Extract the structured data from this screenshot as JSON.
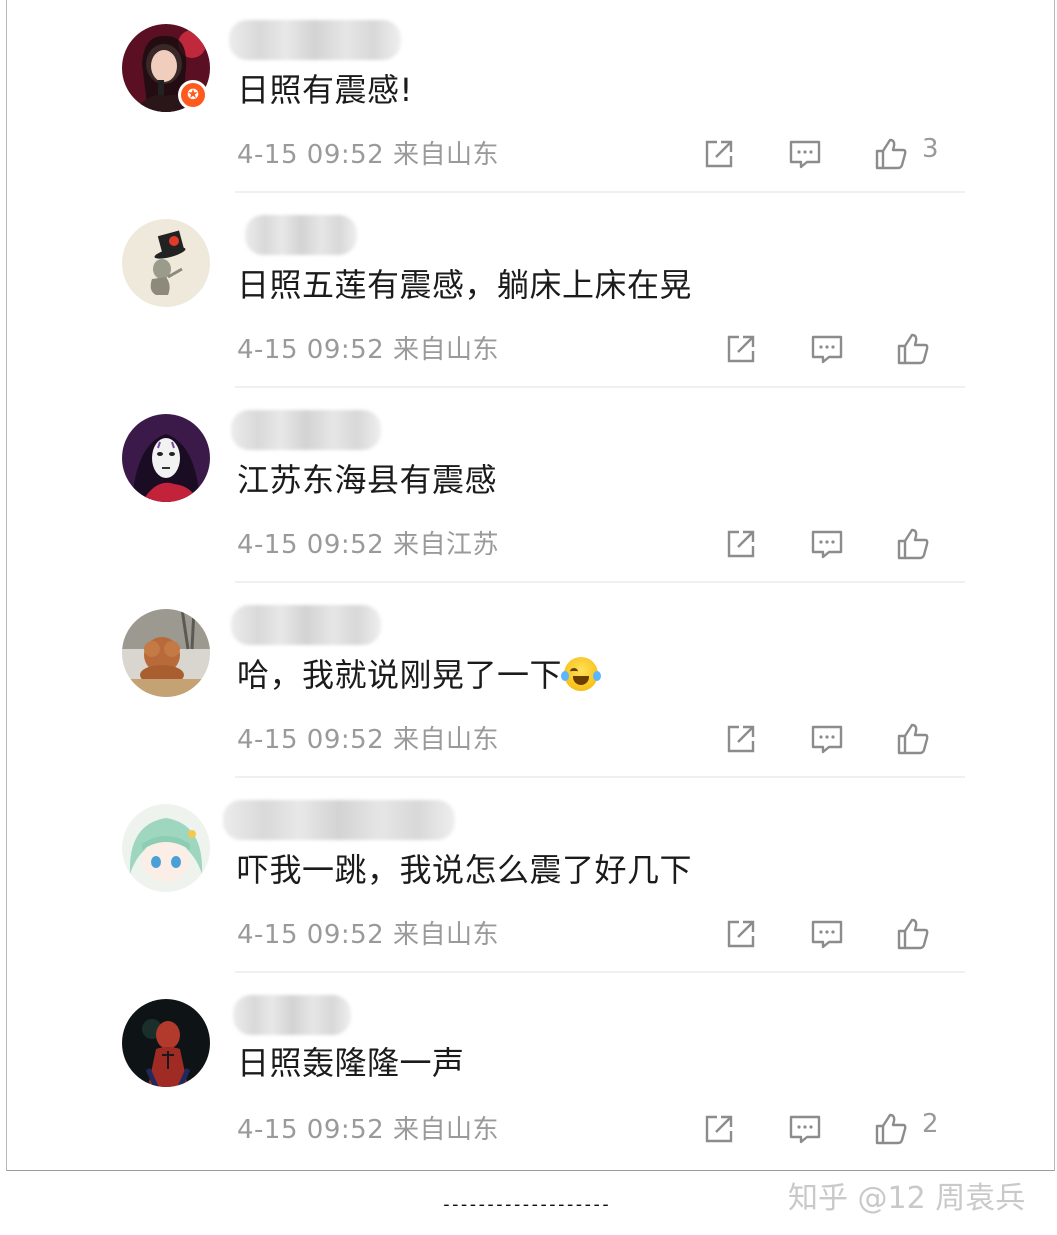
{
  "comments": [
    {
      "text": "日照有震感!",
      "time": "4-15 09:52",
      "location": "来自山东",
      "likes": "3",
      "has_badge": true,
      "avatar_icon": "woman-microphone-avatar"
    },
    {
      "text": "日照五莲有震感，躺床上床在晃",
      "time": "4-15 09:52",
      "location": "来自山东",
      "likes": "",
      "avatar_icon": "cartoon-hat-avatar"
    },
    {
      "text": "江苏东海县有震感",
      "time": "4-15 09:52",
      "location": "来自江苏",
      "likes": "",
      "avatar_icon": "no-face-mask-avatar"
    },
    {
      "text": "哈，我就说刚晃了一下",
      "emoji": "laughing-crying-emoji",
      "time": "4-15 09:52",
      "location": "来自山东",
      "likes": "",
      "avatar_icon": "dog-photo-avatar"
    },
    {
      "text": "吓我一跳，我说怎么震了好几下",
      "time": "4-15 09:52",
      "location": "来自山东",
      "likes": "",
      "avatar_icon": "anime-girl-avatar"
    },
    {
      "text": "日照轰隆隆一声",
      "time": "4-15 09:52",
      "location": "来自山东",
      "likes": "2",
      "avatar_icon": "spiderman-avatar"
    }
  ],
  "icons": {
    "share": "share-icon",
    "reply": "comment-icon",
    "like": "thumbs-up-icon"
  },
  "colors": {
    "meta_text": "#9a9a9a",
    "badge": "#ff5a1e"
  },
  "footer": {
    "dashes": "-------------------",
    "watermark": "知乎 @12 周袁兵"
  }
}
